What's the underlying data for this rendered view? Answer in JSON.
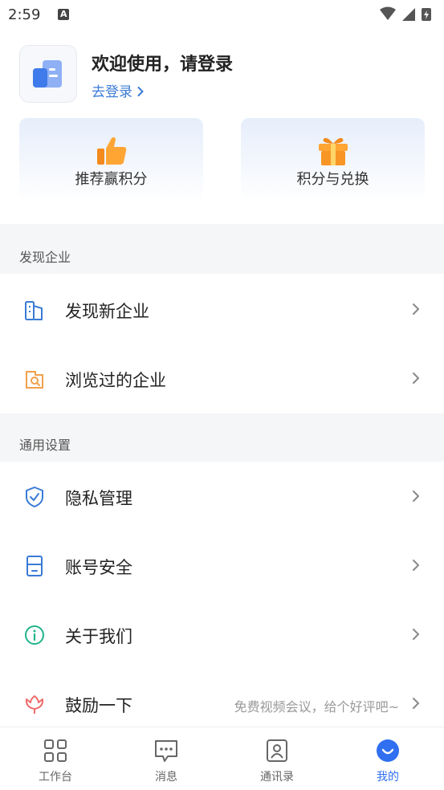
{
  "status_bar": {
    "time": "2:59",
    "notification_icon": "A"
  },
  "profile": {
    "welcome": "欢迎使用，请登录",
    "login_link": "去登录"
  },
  "cards": [
    {
      "label": "推荐赢积分",
      "icon": "thumbs-up-icon"
    },
    {
      "label": "积分与兑换",
      "icon": "gift-icon"
    }
  ],
  "sections": {
    "discover": {
      "title": "发现企业",
      "items": [
        {
          "label": "发现新企业",
          "icon": "building-icon"
        },
        {
          "label": "浏览过的企业",
          "icon": "search-card-icon"
        }
      ]
    },
    "settings": {
      "title": "通用设置",
      "items": [
        {
          "label": "隐私管理",
          "icon": "shield-check-icon"
        },
        {
          "label": "账号安全",
          "icon": "phone-icon"
        },
        {
          "label": "关于我们",
          "icon": "info-icon"
        },
        {
          "label": "鼓励一下",
          "icon": "flower-icon",
          "hint": "免费视频会议，给个好评吧~"
        }
      ]
    }
  },
  "tabbar": [
    {
      "label": "工作台",
      "icon": "grid-icon"
    },
    {
      "label": "消息",
      "icon": "chat-icon"
    },
    {
      "label": "通讯录",
      "icon": "contacts-icon"
    },
    {
      "label": "我的",
      "icon": "smile-icon",
      "active": true
    }
  ],
  "colors": {
    "accent": "#2f6ff0",
    "link": "#3a7bd5",
    "section_bg": "#f5f6f8"
  }
}
